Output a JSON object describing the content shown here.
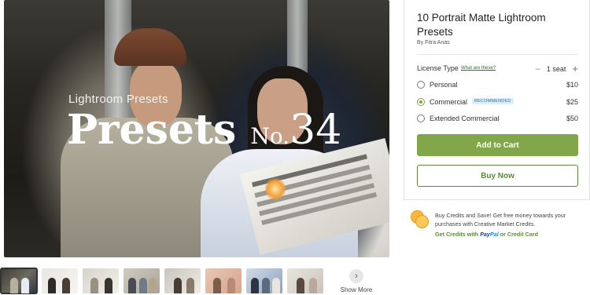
{
  "preview": {
    "kicker": "Lightroom Presets",
    "title_word": "Presets",
    "title_no": "No.",
    "title_number": "34"
  },
  "thumbnails": {
    "count": 8,
    "active_index": 0,
    "show_more_label": "Show More"
  },
  "product": {
    "title": "10 Portrait Matte Lightroom Presets",
    "author_prefix": "By",
    "author_name": "Fitra Anas"
  },
  "license": {
    "label": "License Type",
    "info_link": "What are these?",
    "seats_label": "1 seat",
    "options": [
      {
        "name": "Personal",
        "price": "$10",
        "selected": false,
        "badge": ""
      },
      {
        "name": "Commercial",
        "price": "$25",
        "selected": true,
        "badge": "RECOMMENDED"
      },
      {
        "name": "Extended Commercial",
        "price": "$50",
        "selected": false,
        "badge": ""
      }
    ]
  },
  "actions": {
    "add_to_cart": "Add to Cart",
    "buy_now": "Buy Now"
  },
  "credits": {
    "text": "Buy Credits and Save! Get free money towards your purchases with Creative Market Credits.",
    "link_prefix": "Get Credits with",
    "paypal_pay": "Pay",
    "paypal_pal": "Pal",
    "link_suffix": "or Credit Card"
  },
  "colors": {
    "accent_green": "#82a64a",
    "badge_blue": "#dceefa",
    "coin_gold": "#f7b63e"
  }
}
